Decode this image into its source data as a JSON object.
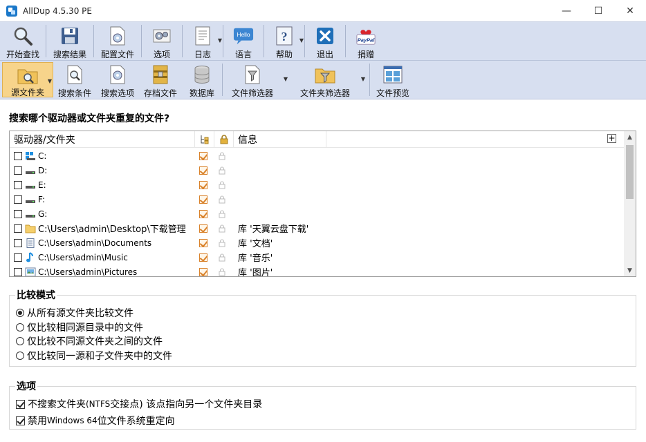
{
  "window": {
    "title": "AllDup 4.5.30 PE",
    "controls": [
      "—",
      "☐",
      "✕"
    ]
  },
  "toolbar_main": [
    {
      "label": "开始查找",
      "icon": "magnifier-icon"
    },
    {
      "label": "搜索结果",
      "icon": "floppy-disk-icon"
    },
    {
      "label": "配置文件",
      "icon": "config-file-icon"
    },
    {
      "label": "选项",
      "icon": "gears-icon"
    },
    {
      "label": "日志",
      "icon": "log-document-icon"
    },
    {
      "label": "语言",
      "icon": "hello-bubble-icon",
      "icon_text": "Hello"
    },
    {
      "label": "帮助",
      "icon": "help-question-icon"
    },
    {
      "label": "退出",
      "icon": "exit-x-icon"
    },
    {
      "label": "捐赠",
      "icon": "paypal-heart-icon",
      "icon_text": "PayPal"
    }
  ],
  "toolbar_sub": [
    {
      "label": "源文件夹",
      "icon": "source-folder-icon",
      "active": true
    },
    {
      "label": "搜索条件",
      "icon": "search-criteria-icon"
    },
    {
      "label": "搜索选项",
      "icon": "search-options-icon"
    },
    {
      "label": "存档文件",
      "icon": "archive-icon"
    },
    {
      "label": "数据库",
      "icon": "database-icon"
    },
    {
      "label": "文件筛选器",
      "icon": "file-filter-icon"
    },
    {
      "label": "文件夹筛选器",
      "icon": "folder-filter-icon"
    },
    {
      "label": "文件预览",
      "icon": "file-preview-icon"
    }
  ],
  "main": {
    "question": "搜索哪个驱动器或文件夹重复的文件?",
    "list": {
      "columns": [
        "驱动器/文件夹",
        "信息"
      ],
      "rows": [
        {
          "path": "C:",
          "icon": "system-drive-icon",
          "info": ""
        },
        {
          "path": "D:",
          "icon": "drive-icon",
          "info": ""
        },
        {
          "path": "E:",
          "icon": "drive-icon",
          "info": ""
        },
        {
          "path": "F:",
          "icon": "drive-icon",
          "info": ""
        },
        {
          "path": "G:",
          "icon": "drive-icon",
          "info": ""
        },
        {
          "path": "C:\\Users\\admin\\Desktop\\下载管理",
          "icon": "folder-icon",
          "info": "库 '天翼云盘下载'"
        },
        {
          "path": "C:\\Users\\admin\\Documents",
          "icon": "documents-icon",
          "info": "库 '文档'"
        },
        {
          "path": "C:\\Users\\admin\\Music",
          "icon": "music-note-icon",
          "info": "库 '音乐'"
        },
        {
          "path": "C:\\Users\\admin\\Pictures",
          "icon": "pictures-icon",
          "info": "库 '图片'"
        }
      ]
    }
  },
  "compare_mode": {
    "title": "比较模式",
    "options": [
      {
        "label": "从所有源文件夹比较文件",
        "selected": true
      },
      {
        "label": "仅比较相同源目录中的文件",
        "selected": false
      },
      {
        "label": "仅比较不同源文件夹之间的文件",
        "selected": false
      },
      {
        "label": "仅比较同一源和子文件夹中的文件",
        "selected": false
      }
    ]
  },
  "options": {
    "title": "选项",
    "items": [
      {
        "pre": "不搜索文件夹 ",
        "small": "(NTFS",
        "post": " 交接点) 该点指向另一个文件夹目录",
        "checked": true
      },
      {
        "pre": "禁用 ",
        "small": "Windows 64",
        "post": " 位文件系统重定向",
        "checked": true
      }
    ]
  },
  "colors": {
    "toolbar_bg": "#d7dff0",
    "active_tab": "#f7d48b",
    "check_orange": "#d9822b"
  }
}
